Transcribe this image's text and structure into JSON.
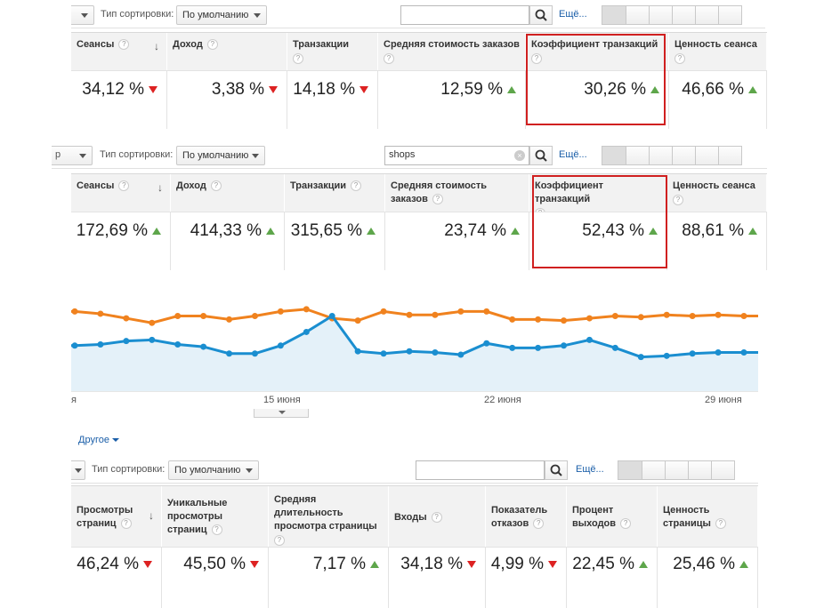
{
  "panel1": {
    "toolbar": {
      "stub": "",
      "sort_label": "Тип сортировки:",
      "sort_value": "По умолчанию",
      "search_value": "",
      "more": "Ещё..."
    },
    "columns": [
      {
        "title": "Сеансы",
        "value": "34,12 %",
        "trend": "down"
      },
      {
        "title": "Доход",
        "value": "3,38 %",
        "trend": "down"
      },
      {
        "title": "Транзакции",
        "value": "14,18 %",
        "trend": "down"
      },
      {
        "title": "Средняя стоимость заказов",
        "value": "12,59 %",
        "trend": "up"
      },
      {
        "title": "Коэффициент транзакций",
        "value": "30,26 %",
        "trend": "up"
      },
      {
        "title": "Ценность сеанса",
        "value": "46,66 %",
        "trend": "up"
      }
    ]
  },
  "panel2": {
    "toolbar": {
      "stub": "р",
      "sort_label": "Тип сортировки:",
      "sort_value": "По умолчанию",
      "search_value": "shops",
      "more": "Ещё..."
    },
    "columns": [
      {
        "title": "Сеансы",
        "value": "172,69 %",
        "trend": "up"
      },
      {
        "title": "Доход",
        "value": "414,33 %",
        "trend": "up"
      },
      {
        "title": "Транзакции",
        "value": "315,65 %",
        "trend": "up"
      },
      {
        "title": "Средняя стоимость заказов",
        "value": "23,74 %",
        "trend": "up"
      },
      {
        "title": "Коэффициент транзакций",
        "value": "52,43 %",
        "trend": "up"
      },
      {
        "title": "Ценность сеанса",
        "value": "88,61 %",
        "trend": "up"
      }
    ]
  },
  "chart": {
    "x_labels": [
      "я",
      "15 июня",
      "22 июня",
      "29 июня"
    ],
    "colors": {
      "orange": "#f0821e",
      "blue": "#1a8ed0",
      "fill": "#e4f1f9"
    }
  },
  "chart_data": {
    "type": "line",
    "x_label_ticks": [
      "15 июня",
      "22 июня",
      "29 июня"
    ],
    "series": [
      {
        "values": [
          70,
          68,
          64,
          60,
          66,
          66,
          63,
          66,
          70,
          72,
          64,
          62,
          70,
          67,
          67,
          70,
          70,
          63,
          63,
          62,
          64,
          66,
          65,
          67,
          66,
          67,
          66
        ]
      },
      {
        "values": [
          40,
          41,
          44,
          45,
          41,
          39,
          33,
          33,
          40,
          52,
          66,
          35,
          33,
          35,
          34,
          32,
          42,
          38,
          38,
          40,
          45,
          38,
          30,
          31,
          33,
          34,
          34
        ]
      }
    ],
    "ylim": [
      0,
      100
    ]
  },
  "panel3": {
    "other_link": "Другое",
    "toolbar": {
      "sort_label": "Тип сортировки:",
      "sort_value": "По умолчанию",
      "search_value": "",
      "more": "Ещё..."
    },
    "columns": [
      {
        "title": "Просмотры страниц",
        "value": "46,24 %",
        "trend": "down"
      },
      {
        "title": "Уникальные просмотры страниц",
        "value": "45,50 %",
        "trend": "down"
      },
      {
        "title": "Средняя длительность просмотра страницы",
        "value": "7,17 %",
        "trend": "up"
      },
      {
        "title": "Входы",
        "value": "34,18 %",
        "trend": "down"
      },
      {
        "title": "Показатель отказов",
        "value": "4,99 %",
        "trend": "down"
      },
      {
        "title": "Процент выходов",
        "value": "22,45 %",
        "trend": "up"
      },
      {
        "title": "Ценность страницы",
        "value": "25,46 %",
        "trend": "up"
      }
    ]
  }
}
